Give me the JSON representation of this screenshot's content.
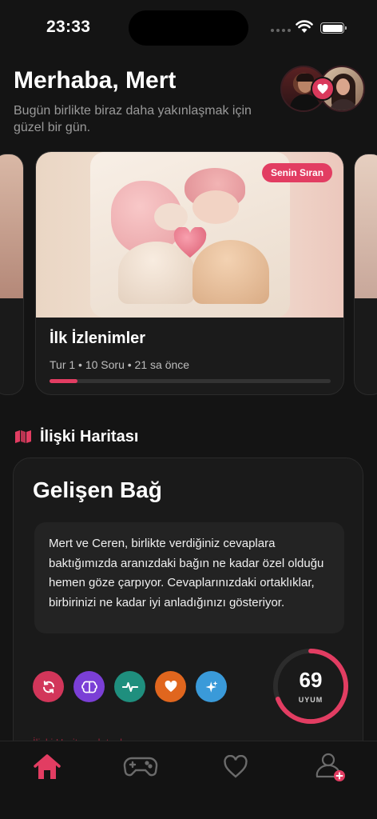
{
  "status_bar": {
    "time": "23:33"
  },
  "header": {
    "greeting": "Merhaba, Mert",
    "subtitle": "Bugün birlikte biraz daha yakınlaşmak için güzel bir gün."
  },
  "carousel": {
    "current": {
      "badge": "Senin Sıran",
      "title": "İlk İzlenimler",
      "meta": "Tur 1 • 10 Soru • 21 sa önce",
      "progress": 0.1
    }
  },
  "relationship_map": {
    "section_title": "İlişki Haritası",
    "title": "Gelişen Bağ",
    "description": "Mert ve Ceren, birlikte verdiğiniz cevaplara baktığımızda aranızdaki bağın ne kadar özel olduğu hemen göze çarpıyor. Cevaplarınızdaki ortaklıklar, birbirinizi ne kadar iyi anladığınızı gösteriyor.",
    "score": "69",
    "score_label": "UYUM",
    "score_fraction": 0.69,
    "chips": [
      {
        "icon": "refresh-icon",
        "color": "#d2365a"
      },
      {
        "icon": "brain-icon",
        "color": "#7b3fd6"
      },
      {
        "icon": "pulse-icon",
        "color": "#1f8f7e"
      },
      {
        "icon": "heart-icon",
        "color": "#e0661e"
      },
      {
        "icon": "sparkle-icon",
        "color": "#3a9ad9"
      }
    ],
    "faded_link": "İlişki Haritası detayları"
  },
  "tabbar": {
    "tabs": [
      {
        "name": "home",
        "icon": "home-icon",
        "active": true
      },
      {
        "name": "games",
        "icon": "gamepad-icon",
        "active": false
      },
      {
        "name": "favorites",
        "icon": "heart-outline-icon",
        "active": false
      },
      {
        "name": "profile",
        "icon": "add-user-icon",
        "active": false
      }
    ]
  },
  "colors": {
    "accent": "#e23d62",
    "background": "#141414",
    "card": "#1a1a1a"
  }
}
